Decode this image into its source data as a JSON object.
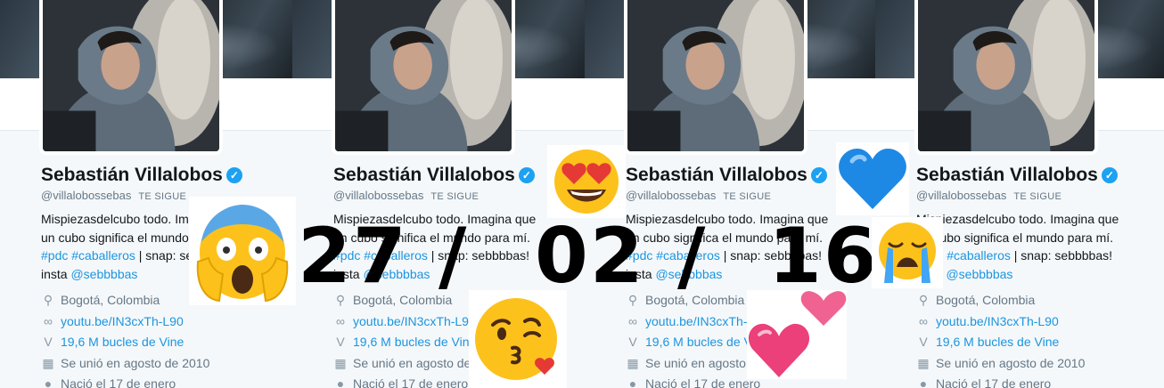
{
  "profile": {
    "name": "Sebastián Villalobos",
    "verified_icon": "✓",
    "handle": "@villalobossebas",
    "follows_you": "TE SIGUE",
    "bio_line1": "Mispiezasdelcubo todo. Imagina que un",
    "bio_line2_prefix": "cubo significa el mundo para mí. ",
    "bio_tag1": "#pdc",
    "bio_tag2": "#caballeros",
    "bio_line3_mid": " | snap: sebbbbas! insta",
    "bio_mention": "@sebbbbas",
    "location": "Bogotá, Colombia",
    "website": "youtu.be/IN3cxTh-L90",
    "vine": "19,6 M bucles de Vine",
    "joined": "Se unió en agosto de 2010",
    "birthday": "Nació el 17 de enero"
  },
  "date": {
    "day": "27",
    "sep1": "/",
    "month": "02",
    "sep2": "/",
    "year": "16"
  },
  "colors": {
    "accent": "#1da1f2",
    "link": "#1b95e0",
    "text": "#14171a",
    "muted": "#657786",
    "background": "#f5f8fa"
  },
  "icons": {
    "location": "location-pin-icon",
    "link": "link-icon",
    "vine": "vine-icon",
    "calendar": "calendar-icon",
    "balloon": "balloon-icon",
    "verified": "verified-badge-icon"
  },
  "stickers": [
    "face-screaming-in-fear-icon",
    "heart-eyes-icon",
    "face-blowing-kiss-icon",
    "blue-heart-icon",
    "loudly-crying-face-icon",
    "two-hearts-icon"
  ]
}
